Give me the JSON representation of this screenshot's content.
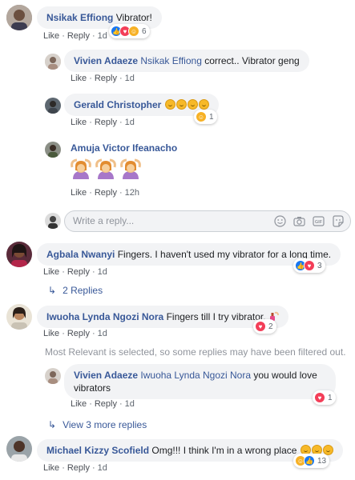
{
  "comments": [
    {
      "author": "Nsikak Effiong",
      "text": "Vibrator!",
      "actions": {
        "like": "Like",
        "reply": "Reply",
        "time": "1d"
      },
      "reactions": {
        "count": "6"
      }
    },
    {
      "author": "Vivien Adaeze",
      "mention": "Nsikak Effiong",
      "text": " correct.. Vibrator geng",
      "actions": {
        "like": "Like",
        "reply": "Reply",
        "time": "1d"
      }
    },
    {
      "author": "Gerald Christopher",
      "actions": {
        "like": "Like",
        "reply": "Reply",
        "time": "1d"
      },
      "reactions": {
        "count": "1"
      }
    },
    {
      "author": "Amuja Victor Ifeanacho",
      "actions": {
        "like": "Like",
        "reply": "Reply",
        "time": "12h"
      }
    },
    {
      "author": "Agbala Nwanyi",
      "text": " Fingers. I haven't used my vibrator for a long time.",
      "actions": {
        "like": "Like",
        "reply": "Reply",
        "time": "1d"
      },
      "reactions": {
        "count": "3"
      },
      "replies_link": "2 Replies"
    },
    {
      "author": "Iwuoha Lynda Ngozi Nora",
      "text": " Fingers till I try vibrator.",
      "actions": {
        "like": "Like",
        "reply": "Reply",
        "time": "1d"
      },
      "reactions": {
        "count": "2"
      }
    },
    {
      "author": "Vivien Adaeze",
      "mention": "Iwuoha Lynda Ngozi Nora",
      "text": " you would love",
      "text2": "vibrators",
      "actions": {
        "like": "Like",
        "reply": "Reply",
        "time": "1d"
      },
      "reactions": {
        "count": "1"
      }
    },
    {
      "author": "Michael Kizzy Scofield",
      "text": " Omg!!! I think I'm in a wrong place",
      "actions": {
        "like": "Like",
        "reply": "Reply",
        "time": "1d"
      },
      "reactions": {
        "count": "13"
      }
    }
  ],
  "reply_box": {
    "placeholder": "Write a reply..."
  },
  "filter_note": "Most Relevant is selected, so some replies may have been filtered out.",
  "view_more": "View 3 more replies",
  "icons": {
    "reply_box": [
      "emoji-icon",
      "camera-icon",
      "gif-icon",
      "sticker-icon"
    ],
    "reply_arrow": "reply-arrow-icon"
  },
  "colors": {
    "author": "#385898",
    "bubble": "#f2f3f5",
    "like": "#1877f2",
    "love": "#f33e58",
    "haha": "#f7b125"
  }
}
